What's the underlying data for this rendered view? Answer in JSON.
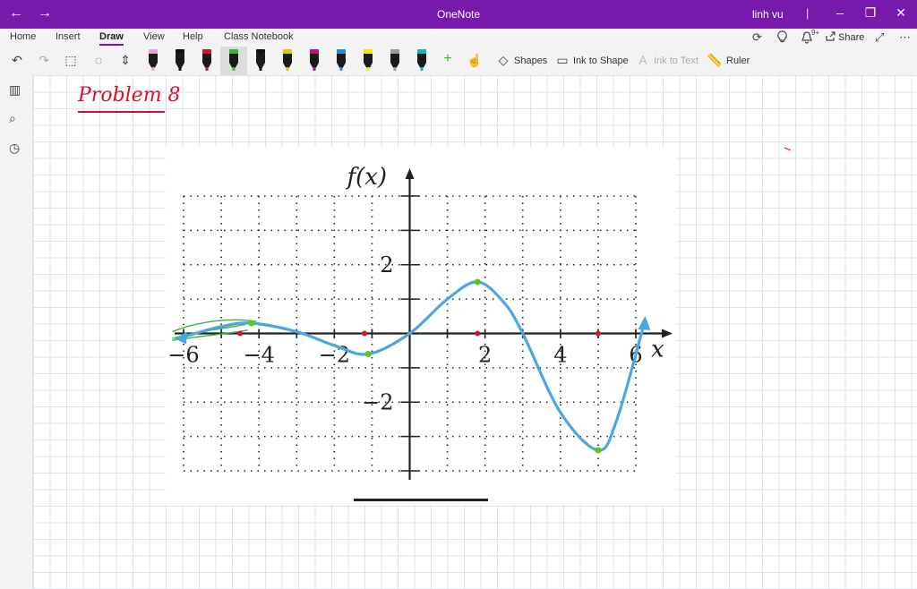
{
  "titlebar": {
    "back": "←",
    "forward": "→",
    "title": "OneNote",
    "user": "linh vu",
    "separator": "|",
    "minimize": "–",
    "restore": "❐",
    "close": "✕"
  },
  "menu": {
    "tabs": [
      "Home",
      "Insert",
      "Draw",
      "View",
      "Help",
      "Class Notebook"
    ],
    "active_tab": "Draw",
    "share": "Share",
    "notifications_count": "9+"
  },
  "toolbar": {
    "shapes": "Shapes",
    "ink_to_shape": "Ink to Shape",
    "ink_to_text": "Ink to Text",
    "ruler": "Ruler",
    "pens": [
      {
        "color": "#e7a0d8"
      },
      {
        "color": "#111111"
      },
      {
        "color": "#d8102a"
      },
      {
        "color": "#3ab53a"
      },
      {
        "color": "#111111"
      },
      {
        "color": "#e0c800"
      },
      {
        "color": "#c0108a"
      },
      {
        "color": "#1a8ed8"
      },
      {
        "color": "#f5e800"
      },
      {
        "color": "#9a9a9a"
      },
      {
        "color": "#16b3b8"
      }
    ],
    "add_pen": "+"
  },
  "page": {
    "handwritten_title": "Problem 8",
    "handwritten_colon": ":"
  },
  "graph": {
    "y_title": "f(x)",
    "x_title": "x",
    "x_tick_labels": [
      "−6",
      "−4",
      "−2",
      "2",
      "4",
      "6"
    ],
    "y_tick_labels": [
      "2",
      "−2"
    ]
  },
  "chart_data": {
    "type": "line",
    "title": "",
    "xlabel": "x",
    "ylabel": "f(x)",
    "xlim": [
      -6,
      6
    ],
    "ylim": [
      -4,
      4
    ],
    "grid": true,
    "x": [
      -6,
      -5,
      -4.2,
      -3,
      -2,
      -1.1,
      0,
      1,
      1.8,
      2.5,
      3,
      4,
      5,
      5.5,
      6.2
    ],
    "y": [
      -0.1,
      0.2,
      0.3,
      0.05,
      -0.35,
      -0.6,
      0,
      1,
      1.5,
      0.9,
      0,
      -2.3,
      -3.4,
      -2.5,
      0.2
    ],
    "color": "#4aa8e0",
    "marker_points_green": [
      [
        -1.1,
        -0.6
      ],
      [
        1.8,
        1.5
      ],
      [
        5,
        -3.4
      ],
      [
        -4.2,
        0.3
      ]
    ],
    "marker_points_red": [
      [
        -4.5,
        0
      ],
      [
        -1.2,
        0
      ],
      [
        1.8,
        0
      ],
      [
        5,
        0
      ]
    ]
  }
}
